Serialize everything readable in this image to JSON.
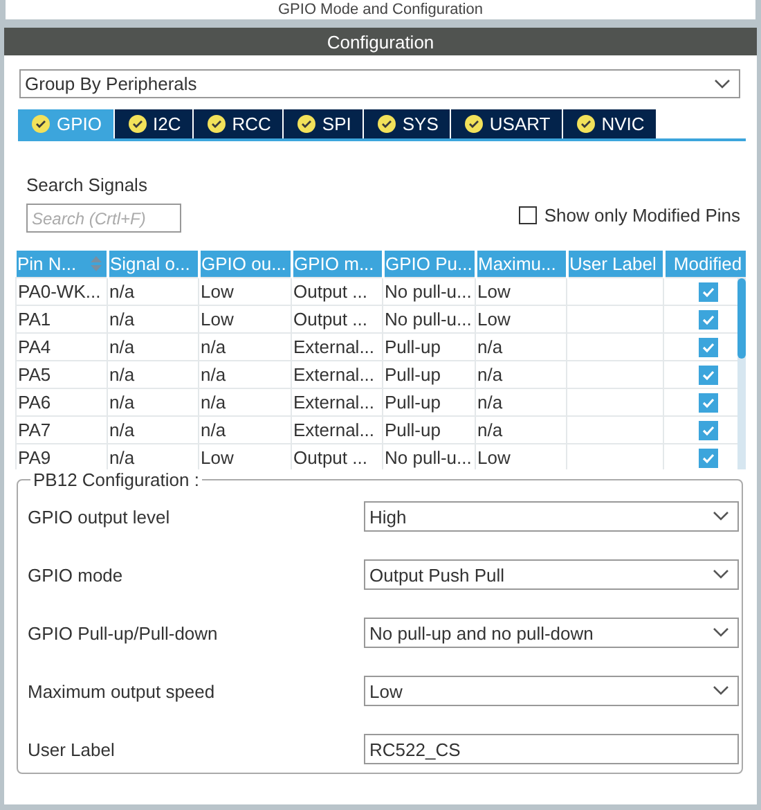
{
  "window": {
    "title": "GPIO Mode and Configuration"
  },
  "panel": {
    "title": "Configuration"
  },
  "group_by": {
    "value": "Group By Peripherals"
  },
  "tabs": [
    {
      "label": "GPIO",
      "selected": true
    },
    {
      "label": "I2C",
      "selected": false
    },
    {
      "label": "RCC",
      "selected": false
    },
    {
      "label": "SPI",
      "selected": false
    },
    {
      "label": "SYS",
      "selected": false
    },
    {
      "label": "USART",
      "selected": false
    },
    {
      "label": "NVIC",
      "selected": false
    }
  ],
  "search": {
    "label": "Search Signals",
    "placeholder": "Search (Crtl+F)"
  },
  "show_only_modified": {
    "label": "Show only Modified Pins",
    "checked": false
  },
  "table": {
    "columns": [
      "Pin N...",
      "Signal o...",
      "GPIO ou...",
      "GPIO m...",
      "GPIO Pu...",
      "Maximu...",
      "User Label",
      "Modified"
    ],
    "rows": [
      {
        "cells": [
          "PA0-WK...",
          "n/a",
          "Low",
          "Output ...",
          "No pull-u...",
          "Low",
          ""
        ],
        "modified": true
      },
      {
        "cells": [
          "PA1",
          "n/a",
          "Low",
          "Output ...",
          "No pull-u...",
          "Low",
          ""
        ],
        "modified": true
      },
      {
        "cells": [
          "PA4",
          "n/a",
          "n/a",
          "External...",
          "Pull-up",
          "n/a",
          ""
        ],
        "modified": true
      },
      {
        "cells": [
          "PA5",
          "n/a",
          "n/a",
          "External...",
          "Pull-up",
          "n/a",
          ""
        ],
        "modified": true
      },
      {
        "cells": [
          "PA6",
          "n/a",
          "n/a",
          "External...",
          "Pull-up",
          "n/a",
          ""
        ],
        "modified": true
      },
      {
        "cells": [
          "PA7",
          "n/a",
          "n/a",
          "External...",
          "Pull-up",
          "n/a",
          ""
        ],
        "modified": true
      },
      {
        "cells": [
          "PA9",
          "n/a",
          "Low",
          "Output ...",
          "No pull-u...",
          "Low",
          ""
        ],
        "modified": true
      }
    ]
  },
  "pin_config": {
    "title": "PB12 Configuration :",
    "fields": [
      {
        "label": "GPIO output level",
        "kind": "dropdown",
        "value": "High"
      },
      {
        "label": "GPIO mode",
        "kind": "dropdown",
        "value": "Output Push Pull"
      },
      {
        "label": "GPIO Pull-up/Pull-down",
        "kind": "dropdown",
        "value": "No pull-up and no pull-down"
      },
      {
        "label": "Maximum output speed",
        "kind": "dropdown",
        "value": "Low"
      },
      {
        "label": "User Label",
        "kind": "text",
        "value": "RC522_CS"
      }
    ]
  }
}
